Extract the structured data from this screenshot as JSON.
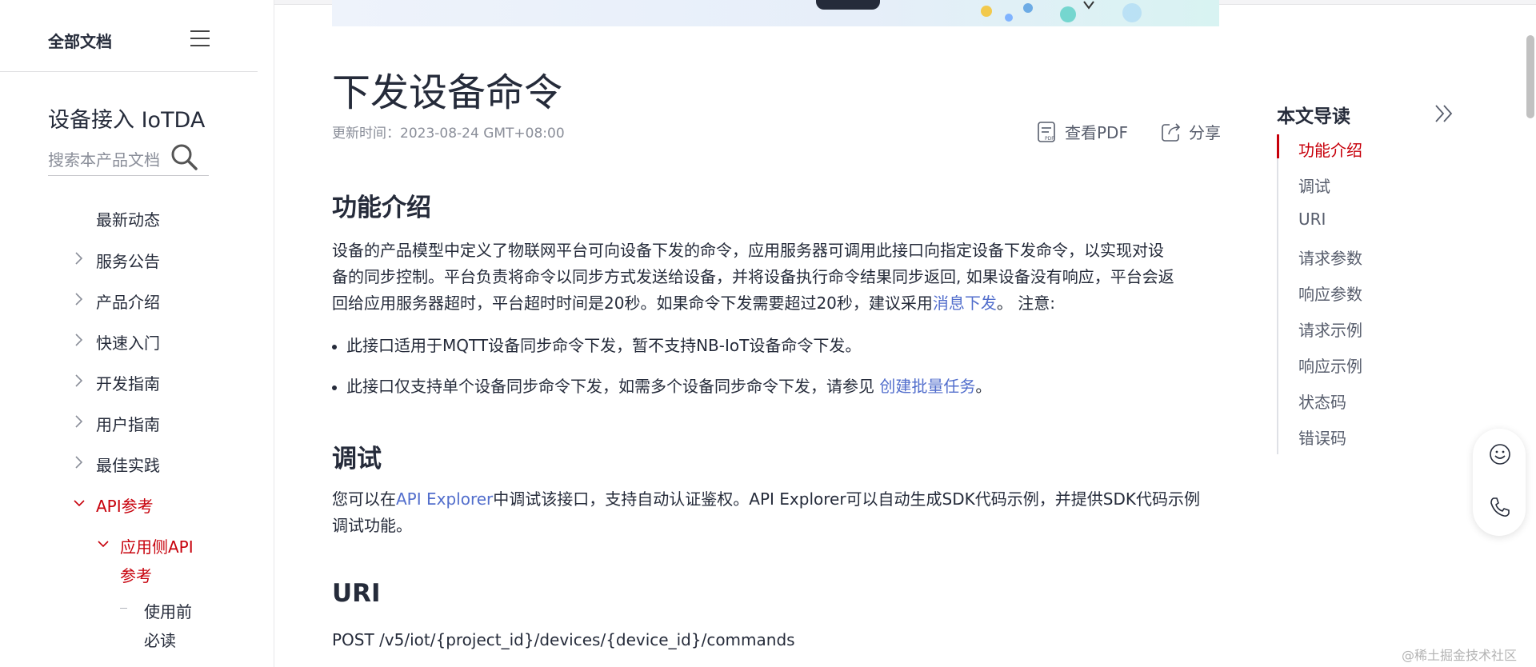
{
  "sidebar": {
    "all_docs": "全部文档",
    "product": "设备接入 IoTDA",
    "search_placeholder": "搜索本产品文档",
    "items": [
      {
        "label": "最新动态"
      },
      {
        "label": "服务公告"
      },
      {
        "label": "产品介绍"
      },
      {
        "label": "快速入门"
      },
      {
        "label": "开发指南"
      },
      {
        "label": "用户指南"
      },
      {
        "label": "最佳实践"
      },
      {
        "label": "API参考"
      },
      {
        "label": "应用侧API"
      },
      {
        "label": "参考"
      },
      {
        "label": "使用前"
      },
      {
        "label": "必读"
      }
    ]
  },
  "article": {
    "title": "下发设备命令",
    "updated": "更新时间：2023-08-24 GMT+08:00",
    "view_pdf": "查看PDF",
    "share": "分享",
    "sections": {
      "intro": {
        "heading": "功能介绍",
        "line1": "设备的产品模型中定义了物联网平台可向设备下发的命令，应用服务器可调用此接口向指定设备下发命令，以实现对设",
        "line2": "备的同步控制。平台负责将命令以同步方式发送给设备，并将设备执行命令结果同步返回, 如果设备没有响应，平台会返",
        "line3_a": "回给应用服务器超时，平台超时时间是20秒。如果命令下发需要超过20秒，建议采用",
        "line3_link": "消息下发",
        "line3_b": "。 注意:",
        "bullet1": "此接口适用于MQTT设备同步命令下发，暂不支持NB-IoT设备命令下发。",
        "bullet2_a": "此接口仅支持单个设备同步命令下发，如需多个设备同步命令下发，请参见 ",
        "bullet2_link": "创建批量任务",
        "bullet2_b": "。"
      },
      "debug": {
        "heading": "调试",
        "line1_a": "您可以在",
        "line1_link": "API Explorer",
        "line1_b": "中调试该接口，支持自动认证鉴权。API Explorer可以自动生成SDK代码示例，并提供SDK代码示例",
        "line2": "调试功能。"
      },
      "uri": {
        "heading": "URI",
        "value": "POST /v5/iot/{project_id}/devices/{device_id}/commands"
      }
    }
  },
  "toc": {
    "title": "本文导读",
    "items": [
      {
        "label": "功能介绍"
      },
      {
        "label": "调试"
      },
      {
        "label": "URI"
      },
      {
        "label": "请求参数"
      },
      {
        "label": "响应参数"
      },
      {
        "label": "请求示例"
      },
      {
        "label": "响应示例"
      },
      {
        "label": "状态码"
      },
      {
        "label": "错误码"
      }
    ]
  },
  "watermark": "@稀土掘金技术社区",
  "colors": {
    "accent": "#c7000b",
    "link": "#526ecc",
    "text": "#252b3a",
    "muted": "#8a8e99"
  },
  "icons": [
    "menu-icon",
    "search-icon",
    "chevron-right-icon",
    "chevron-down-icon",
    "pdf-icon",
    "share-icon",
    "double-chevron-right-icon",
    "smile-icon",
    "phone-icon"
  ]
}
